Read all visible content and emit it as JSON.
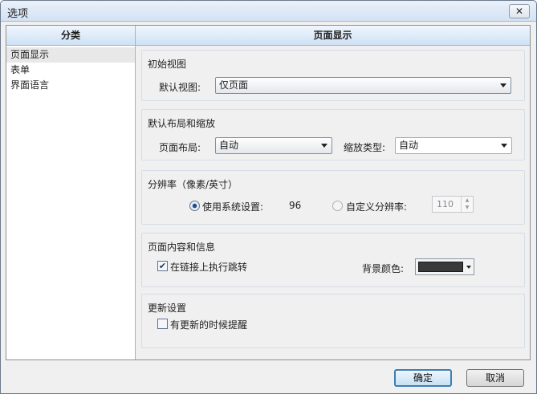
{
  "window": {
    "title": "选项",
    "close_glyph": "✕"
  },
  "category_pane": {
    "header": "分类",
    "items": [
      {
        "label": "页面显示",
        "selected": true
      },
      {
        "label": "表单",
        "selected": false
      },
      {
        "label": "界面语言",
        "selected": false
      }
    ]
  },
  "content": {
    "header": "页面显示",
    "initial_view": {
      "title": "初始视图",
      "default_view_label": "默认视图:",
      "default_view_value": "仅页面"
    },
    "layout_zoom": {
      "title": "默认布局和缩放",
      "page_layout_label": "页面布局:",
      "page_layout_value": "自动",
      "zoom_type_label": "缩放类型:",
      "zoom_type_value": "自动"
    },
    "resolution": {
      "title": "分辨率（像素/英寸）",
      "system_option_label": "使用系统设置:",
      "system_value": "96",
      "custom_option_label": "自定义分辨率:",
      "custom_value": "110",
      "selected_option": "system"
    },
    "page_content": {
      "title": "页面内容和信息",
      "follow_links_label": "在链接上执行跳转",
      "follow_links_checked": true,
      "bg_color_label": "背景颜色:",
      "bg_color": "#3a3a3a"
    },
    "updates": {
      "title": "更新设置",
      "notify_label": "有更新的时候提醒",
      "notify_checked": false
    }
  },
  "buttons": {
    "ok": "确定",
    "cancel": "取消"
  },
  "colors": {
    "titlebar": "#d3e2f3",
    "header": "#cfe1f5",
    "default_button_border": "#3c7fb1"
  }
}
